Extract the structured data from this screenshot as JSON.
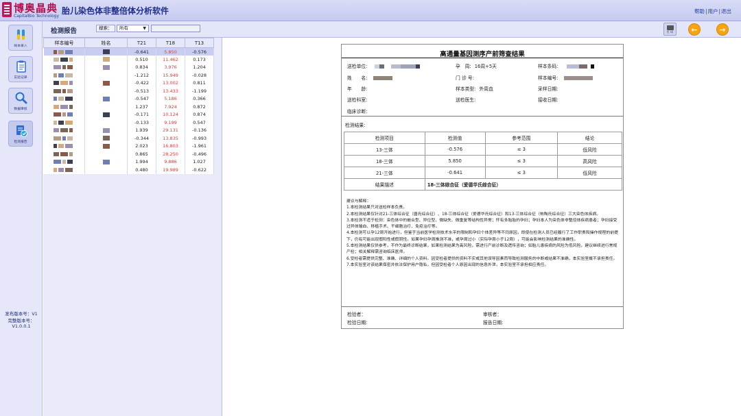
{
  "header": {
    "logo_text": "博奥晶典",
    "logo_subtext": "CapitalBio Technology",
    "app_title": "胎儿染色体非整倍体分析软件",
    "links": [
      "帮助",
      "用户",
      "退出"
    ]
  },
  "sidebar": {
    "items": [
      {
        "label": "样本录入",
        "icon": "test-tubes-icon"
      },
      {
        "label": "实验记录",
        "icon": "clipboard-icon"
      },
      {
        "label": "数据审核",
        "icon": "magnifier-icon"
      },
      {
        "label": "检测报告",
        "icon": "report-check-icon"
      }
    ],
    "version_lines": [
      "发布版本号：V1",
      "完整版本号：",
      "V1.0.0.1"
    ]
  },
  "toolbar": {
    "title": "检测报告",
    "search_label": "搜索：",
    "search_option": "所有",
    "search_value": "",
    "print_label": "打 印"
  },
  "sample_table": {
    "columns": [
      "样本编号",
      "姓名",
      "T21",
      "T18",
      "T13"
    ],
    "rows": [
      {
        "t21": "-0.641",
        "t18": "5.850",
        "t13": "-0.576",
        "selected": true
      },
      {
        "t21": "0.510",
        "t18": "11.462",
        "t13": "0.173"
      },
      {
        "t21": "0.834",
        "t18": "3.976",
        "t13": "1.204"
      },
      {
        "t21": "-1.212",
        "t18": "15.949",
        "t13": "-0.028"
      },
      {
        "t21": "-0.422",
        "t18": "13.002",
        "t13": "0.811"
      },
      {
        "t21": "-0.513",
        "t18": "13.433",
        "t13": "-1.199"
      },
      {
        "t21": "-0.547",
        "t18": "5.186",
        "t13": "0.366"
      },
      {
        "t21": "1.237",
        "t18": "7.924",
        "t13": "0.872"
      },
      {
        "t21": "-0.171",
        "t18": "10.124",
        "t13": "0.874"
      },
      {
        "t21": "-0.133",
        "t18": "9.199",
        "t13": "0.547"
      },
      {
        "t21": "1.939",
        "t18": "29.131",
        "t13": "-0.136"
      },
      {
        "t21": "-0.344",
        "t18": "13.835",
        "t13": "-0.993"
      },
      {
        "t21": "2.023",
        "t18": "16.803",
        "t13": "-1.961"
      },
      {
        "t21": "0.865",
        "t18": "28.250",
        "t13": "-0.496"
      },
      {
        "t21": "1.994",
        "t18": "9.886",
        "t13": "1.027"
      },
      {
        "t21": "0.480",
        "t18": "19.989",
        "t13": "-0.622"
      }
    ]
  },
  "report": {
    "title": "高通量基因测序产前筛查结果",
    "fields": {
      "unit_label": "送检单位:",
      "gest_label": "孕　周:",
      "gest_value": "16周+5天",
      "barcode_label": "样本条码:",
      "name_label": "姓　　名:",
      "outpatient_label": "门 诊 号:",
      "sample_no_label": "样本编号:",
      "age_label": "年　　龄:",
      "sample_type_label": "样本类型:",
      "sample_type_value": "外周血",
      "collect_date_label": "采样日期:",
      "dept_label": "送检科室:",
      "doctor_label": "送检医生:",
      "receive_date_label": "接收日期:",
      "diagnosis_label": "临床诊断:"
    },
    "results_label": "检测结果:",
    "result_headers": [
      "检测项目",
      "检测值",
      "参考范围",
      "结论"
    ],
    "results": [
      {
        "item": "13-三体",
        "value": "-0.576",
        "range": "≤ 3",
        "conclusion": "低风险"
      },
      {
        "item": "18-三体",
        "value": "5.850",
        "range": "≤ 3",
        "conclusion": "高风险"
      },
      {
        "item": "21-三体",
        "value": "-0.641",
        "range": "≤ 3",
        "conclusion": "低风险"
      }
    ],
    "desc_label": "结果描述",
    "desc_value": "18-三体综合征（爱德华氏综合征）",
    "advice": [
      "建议与解释：",
      "1.本检测结果只对送检样本负责。",
      "2.本检测结果仅针对21-三体综合征（唐氏综合征）、18-三体综合征（爱德华氏综合征）和13-三体综合征（帕陶氏综合征）三大染色体疾病。",
      "3.本检测不适于检测：染色体中的嵌合型、异位型、微缺失、微重复等结构性异常；怀有多胎胎的孕妇；孕妇本人为染色体非整倍体疾病患者；孕妇接受过异体输血、移植手术、干细胞治疗、免疫治疗等。",
      "4.本检测可以孕12周开始进行，但鉴于当前医学检测技术水平的限制和孕妇个体差异等不同原因，即使在检测人员已经履行了工作职责和操作规程的前提下，仍有可能出现假阳性或假阴性。如果孕妇孕周推测不准，或孕周过小（实际孕周小于12周），可能会影响检测结果的准确性。",
      "5.本检测结果仅供参考，不作为最终诊断结果，如果检测结果为高风险，需进行产前诊断及遗传咨询；如胎儿患疾病的风险为低风险，建议继续进行常规产检；相关解释需咨询临床医师。",
      "6.受检者需提供完整、准确、详细的个人资料。因受检者提供的资料不实或其他误导因素而导致检测服务的中断或结果不准确，本实验室概不承担责任。",
      "7.本实验室对该结果保密并依法保护用户隐私，但因受检者个人原因出现的信息外泄，本实验室不承担相应责任。"
    ],
    "signatures": {
      "tester": "检验者：",
      "reviewer": "审核者：",
      "test_date": "检验日期:",
      "report_date": "报告日期:"
    }
  },
  "colors": {
    "header_bg": "#c6cbf0",
    "sidebar_bg": "#e6e8fa",
    "accent_red": "#e53935",
    "nav_orange": "#f6a413",
    "logo_red": "#b0124e"
  }
}
